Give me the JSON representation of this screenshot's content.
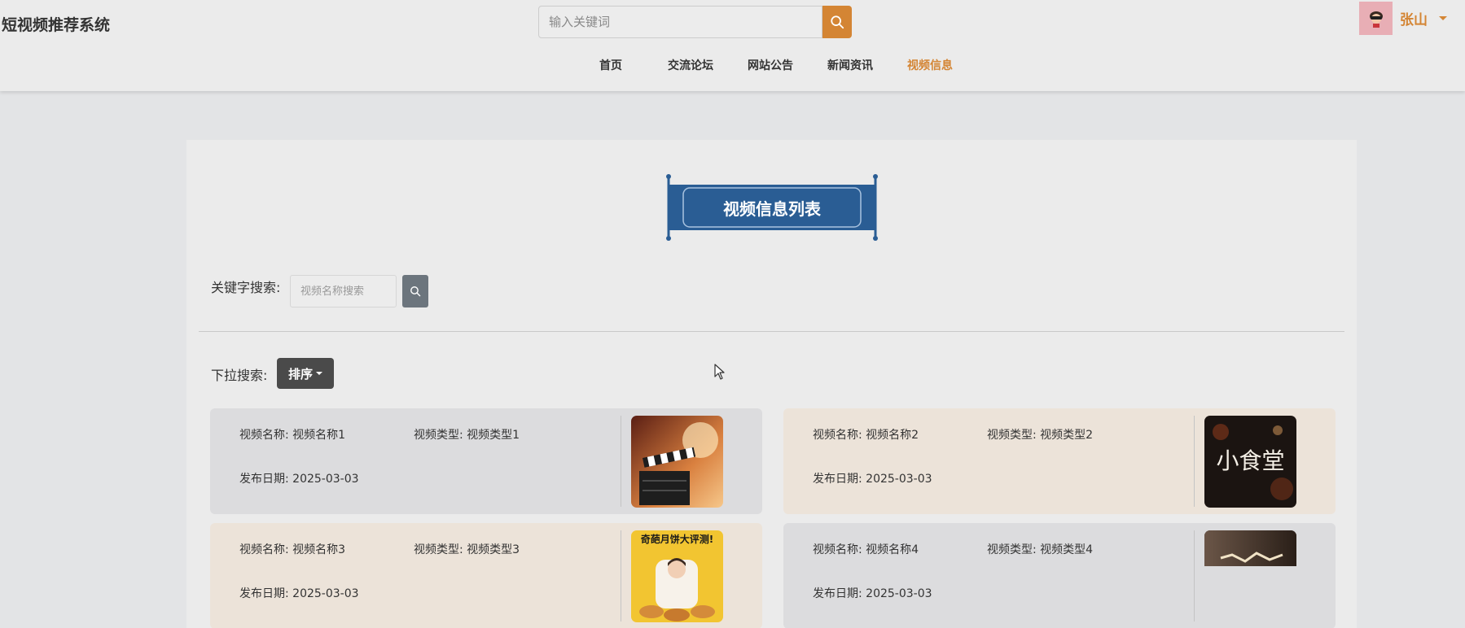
{
  "header": {
    "site_title": "短视频推荐系统",
    "search_placeholder": "输入关键词",
    "search_icon": "search-icon",
    "user_name": "张山",
    "accent_color": "#d48534"
  },
  "nav": {
    "items": [
      {
        "label": "首页"
      },
      {
        "label": "交流论坛"
      },
      {
        "label": "网站公告"
      },
      {
        "label": "新闻资讯"
      },
      {
        "label": "视频信息",
        "active": true
      }
    ]
  },
  "page": {
    "banner_title": "视频信息列表",
    "banner_color": "#2a5d94",
    "keyword_label": "关键字搜索:",
    "keyword_placeholder": "视频名称搜索",
    "dropdown_label": "下拉搜索:",
    "sort_label": "排序"
  },
  "videos": [
    {
      "name_label": "视频名称:",
      "name": "视频名称1",
      "type_label": "视频类型:",
      "type": "视频类型1",
      "date_label": "发布日期:",
      "date": "2025-03-03"
    },
    {
      "name_label": "视频名称:",
      "name": "视频名称2",
      "type_label": "视频类型:",
      "type": "视频类型2",
      "date_label": "发布日期:",
      "date": "2025-03-03"
    },
    {
      "name_label": "视频名称:",
      "name": "视频名称3",
      "type_label": "视频类型:",
      "type": "视频类型3",
      "date_label": "发布日期:",
      "date": "2025-03-03"
    },
    {
      "name_label": "视频名称:",
      "name": "视频名称4",
      "type_label": "视频类型:",
      "type": "视频类型4",
      "date_label": "发布日期:",
      "date": "2025-03-03"
    }
  ],
  "thumbnails": {
    "video2_text": "小食堂",
    "video3_text": "奇葩月饼大评测!"
  }
}
